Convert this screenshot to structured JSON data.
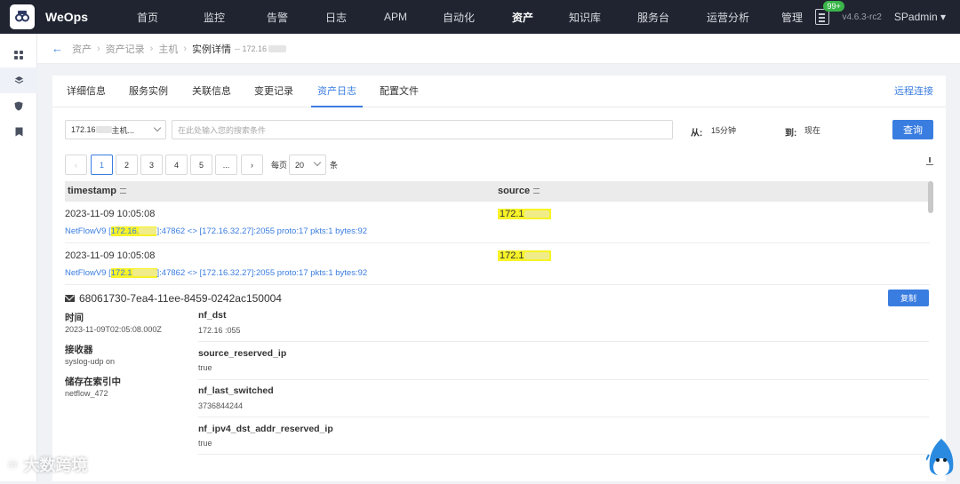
{
  "app": {
    "name": "WeOps",
    "version": "v4.6.3-rc2",
    "user": "SPadmin",
    "notif_badge": "99+"
  },
  "nav": [
    "首页",
    "监控",
    "告警",
    "日志",
    "APM",
    "自动化",
    "资产",
    "知识库",
    "服务台",
    "运营分析",
    "管理"
  ],
  "breadcrumb": {
    "items": [
      "资产",
      "资产记录",
      "主机"
    ],
    "current": "实例详情",
    "suffix": "-- 172.16"
  },
  "tabs": [
    "详细信息",
    "服务实例",
    "关联信息",
    "变更记录",
    "资产日志",
    "配置文件"
  ],
  "remote_label": "远程连接",
  "filters": {
    "host_select": "172.16",
    "host_select_suffix": "主机...",
    "search_placeholder": "在此处输入您的搜索条件",
    "from_label": "从:",
    "from_value": "15分钟",
    "to_label": "到:",
    "to_value": "现在",
    "query_button": "查询"
  },
  "pager": {
    "pages": [
      "1",
      "2",
      "3",
      "4",
      "5",
      "..."
    ],
    "per_page_label": "每页",
    "per_page_value": "20",
    "unit": "条"
  },
  "table": {
    "columns": [
      "timestamp",
      "source"
    ],
    "rows": [
      {
        "timestamp": "2023-11-09 10:05:08",
        "source": "172.1",
        "msg_prefix": "NetFlowV9 [",
        "msg_ip": "172.16.",
        "msg_rest": "]:47862 <> [172.16.32.27]:2055 proto:17 pkts:1 bytes:92"
      },
      {
        "timestamp": "2023-11-09 10:05:08",
        "source": "172.1",
        "msg_prefix": "NetFlowV9 [",
        "msg_ip": "172.1",
        "msg_rest": "]:47862 <> [172.16.32.27]:2055 proto:17 pkts:1 bytes:92"
      }
    ]
  },
  "detail": {
    "id": "68061730-7ea4-11ee-8459-0242ac150004",
    "copy_label": "复制",
    "time_label": "时间",
    "time_value": "2023-11-09T02:05:08.000Z",
    "receiver_label": "接收器",
    "receiver_value": "syslog-udp on",
    "index_label": "储存在索引中",
    "index_value": "netflow_472",
    "fields": [
      {
        "key": "nf_dst",
        "value": "172.16          :055"
      },
      {
        "key": "source_reserved_ip",
        "value": "true"
      },
      {
        "key": "nf_last_switched",
        "value": "3736844244"
      },
      {
        "key": "nf_ipv4_dst_addr_reserved_ip",
        "value": "true"
      }
    ]
  },
  "watermark": "大数跨境"
}
